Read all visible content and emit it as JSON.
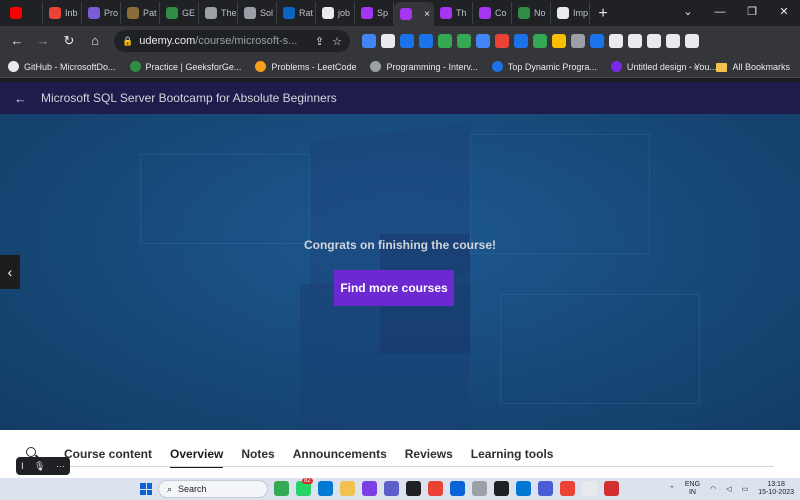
{
  "browser": {
    "tabs": [
      {
        "label": "",
        "color": "#ff0000"
      },
      {
        "label": "Inb",
        "color": "#ea4335"
      },
      {
        "label": "Pro",
        "color": "#7b5cd6"
      },
      {
        "label": "Pat",
        "color": "#8a6d3b"
      },
      {
        "label": "GE",
        "color": "#2f8d46"
      },
      {
        "label": "The",
        "color": "#9aa0a6"
      },
      {
        "label": "Sol",
        "color": "#9aa0a6"
      },
      {
        "label": "Rat",
        "color": "#0a66c2"
      },
      {
        "label": "job",
        "color": "#e8eaed"
      },
      {
        "label": "Sp",
        "color": "#a435f0"
      },
      {
        "label": "",
        "color": "#a435f0",
        "active": true
      },
      {
        "label": "Th",
        "color": "#a435f0"
      },
      {
        "label": "Co",
        "color": "#a435f0"
      },
      {
        "label": "No",
        "color": "#2f8d46"
      },
      {
        "label": "Imp",
        "color": "#e8eaed"
      }
    ],
    "tab_close_glyph": "×",
    "new_tab_glyph": "+",
    "window_controls": {
      "menu": "⌄",
      "minimize": "—",
      "restore": "❐",
      "close": "✕"
    },
    "toolbar": {
      "back": "←",
      "forward": "→",
      "reload": "↻",
      "home": "⌂",
      "url_host": "udemy.com",
      "url_path": "/course/microsoft-s...",
      "share_icon": "⇪",
      "star_icon": "☆"
    },
    "extension_colors": [
      "#4285f4",
      "#e8eaed",
      "#1a73e8",
      "#1a73e8",
      "#34a853",
      "#34a853",
      "#4285f4",
      "#ea4335",
      "#1a73e8",
      "#34a853",
      "#fbbc04",
      "#9aa0a6",
      "#1a73e8",
      "#e8eaed",
      "#e8eaed",
      "#e8eaed",
      "#e8eaed",
      "#e8eaed"
    ],
    "bookmarks": [
      {
        "label": "GitHub - MicrosoftDo...",
        "color": "#e8eaed"
      },
      {
        "label": "Practice | GeeksforGe...",
        "color": "#2f8d46"
      },
      {
        "label": "Problems - LeetCode",
        "color": "#f89f1b"
      },
      {
        "label": "Programming - Interv...",
        "color": "#9aa0a6"
      },
      {
        "label": "Top Dynamic Progra...",
        "color": "#1a73e8"
      },
      {
        "label": "Untitled design - You...",
        "color": "#7d2ae8"
      }
    ],
    "bookmarks_overflow": "»",
    "all_bookmarks": "All Bookmarks"
  },
  "course": {
    "back_arrow": "←",
    "title": "Microsoft SQL Server Bootcamp for Absolute Beginners",
    "congrats_text": "Congrats on finishing the course!",
    "find_more_button": "Find more courses",
    "side_arrow": "‹",
    "tabs": [
      {
        "label": "Course content",
        "active": false
      },
      {
        "label": "Overview",
        "active": true
      },
      {
        "label": "Notes",
        "active": false
      },
      {
        "label": "Announcements",
        "active": false
      },
      {
        "label": "Reviews",
        "active": false
      },
      {
        "label": "Learning tools",
        "active": false
      }
    ],
    "accent_color": "#6d28d2"
  },
  "voice_toolbar": {
    "cursor": "I",
    "mic": "🎙",
    "more": "···"
  },
  "taskbar": {
    "search_placeholder": "Search",
    "whatsapp_badge": "82",
    "app_colors": [
      "#34a853",
      "#25d366",
      "#0078d4",
      "#f2c14e",
      "#7b3fe4",
      "#5b5fc7",
      "#202124",
      "#ea4335",
      "#0a64d8",
      "#9aa0a6",
      "#202124",
      "#0078d4",
      "#4a5cd6",
      "#ea4335",
      "#e8eaed",
      "#d32f2f"
    ],
    "language": {
      "line1": "ENG",
      "line2": "IN"
    },
    "clock": {
      "time": "13:18",
      "date": "15-10-2023"
    }
  }
}
